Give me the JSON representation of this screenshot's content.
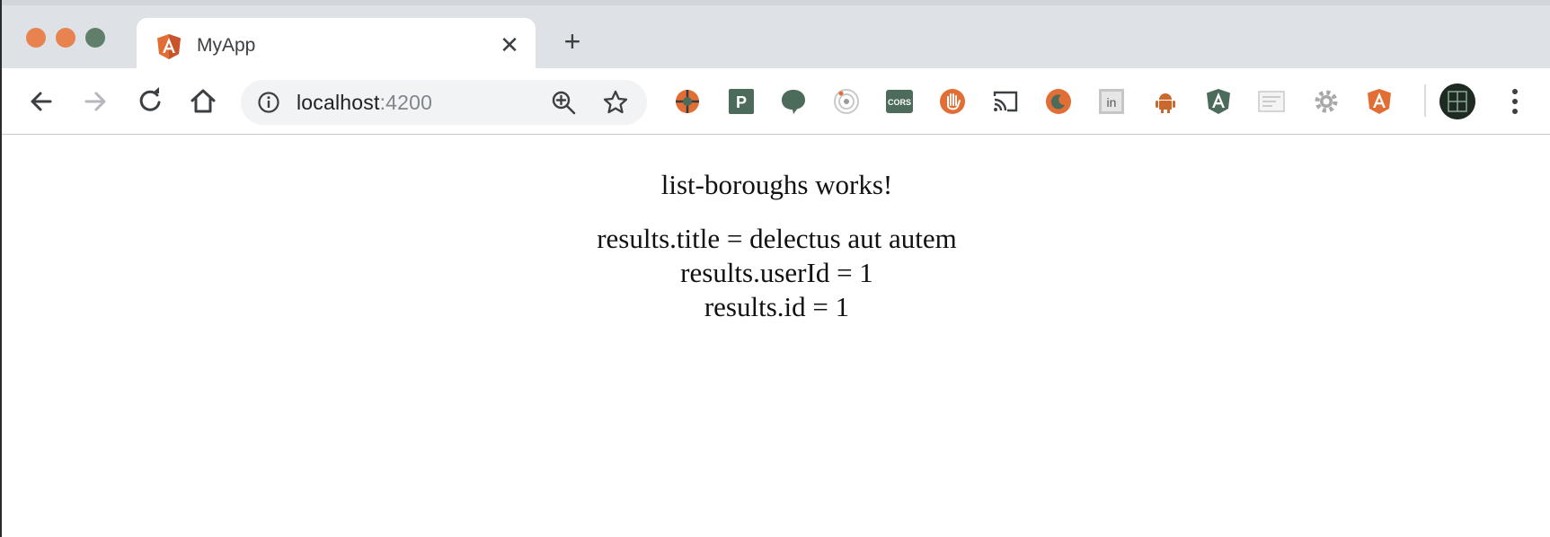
{
  "tab": {
    "title": "MyApp",
    "close_symbol": "✕"
  },
  "newtab_symbol": "+",
  "address": {
    "host": "localhost",
    "port": ":4200"
  },
  "extensions": [
    "pulse-icon",
    "p-extension-icon",
    "chat-bubble-icon",
    "radar-icon",
    "cors-icon",
    "hand-icon",
    "cast-icon",
    "moon-icon",
    "linkedin-icon",
    "android-icon",
    "angular-dark-icon",
    "card-icon",
    "gear-icon",
    "angular-orange-icon"
  ],
  "colors": {
    "close": "#e8834f",
    "minimize": "#e8834f",
    "maximize": "#5f7f6a",
    "accent_green": "#4d6b5a",
    "angular_orange": "#e16f35"
  },
  "page": {
    "heading": "list-boroughs works!",
    "results": [
      "results.title = delectus aut autem",
      "results.userId = 1",
      "results.id = 1"
    ]
  }
}
